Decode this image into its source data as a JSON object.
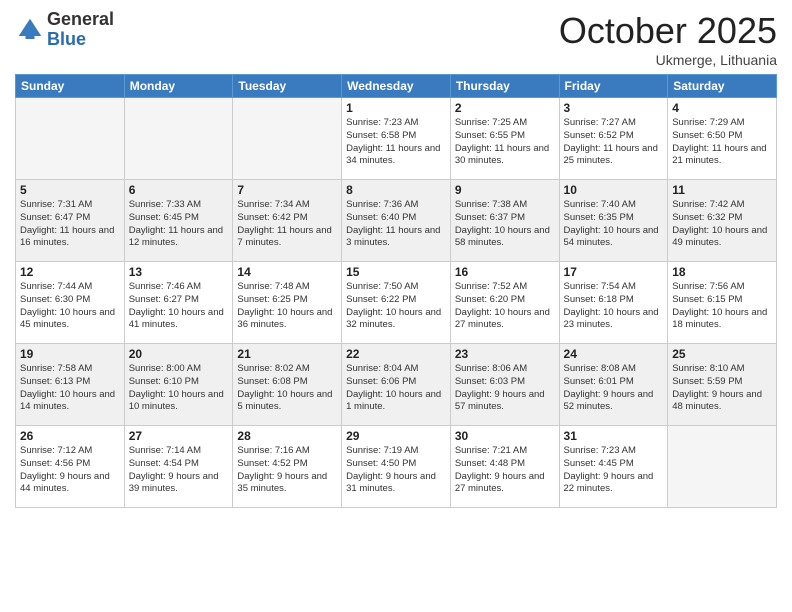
{
  "header": {
    "logo_general": "General",
    "logo_blue": "Blue",
    "month": "October 2025",
    "location": "Ukmerge, Lithuania"
  },
  "weekdays": [
    "Sunday",
    "Monday",
    "Tuesday",
    "Wednesday",
    "Thursday",
    "Friday",
    "Saturday"
  ],
  "weeks": [
    [
      {
        "day": "",
        "sunrise": "",
        "sunset": "",
        "daylight": "",
        "empty": true
      },
      {
        "day": "",
        "sunrise": "",
        "sunset": "",
        "daylight": "",
        "empty": true
      },
      {
        "day": "",
        "sunrise": "",
        "sunset": "",
        "daylight": "",
        "empty": true
      },
      {
        "day": "1",
        "sunrise": "Sunrise: 7:23 AM",
        "sunset": "Sunset: 6:58 PM",
        "daylight": "Daylight: 11 hours and 34 minutes."
      },
      {
        "day": "2",
        "sunrise": "Sunrise: 7:25 AM",
        "sunset": "Sunset: 6:55 PM",
        "daylight": "Daylight: 11 hours and 30 minutes."
      },
      {
        "day": "3",
        "sunrise": "Sunrise: 7:27 AM",
        "sunset": "Sunset: 6:52 PM",
        "daylight": "Daylight: 11 hours and 25 minutes."
      },
      {
        "day": "4",
        "sunrise": "Sunrise: 7:29 AM",
        "sunset": "Sunset: 6:50 PM",
        "daylight": "Daylight: 11 hours and 21 minutes."
      }
    ],
    [
      {
        "day": "5",
        "sunrise": "Sunrise: 7:31 AM",
        "sunset": "Sunset: 6:47 PM",
        "daylight": "Daylight: 11 hours and 16 minutes."
      },
      {
        "day": "6",
        "sunrise": "Sunrise: 7:33 AM",
        "sunset": "Sunset: 6:45 PM",
        "daylight": "Daylight: 11 hours and 12 minutes."
      },
      {
        "day": "7",
        "sunrise": "Sunrise: 7:34 AM",
        "sunset": "Sunset: 6:42 PM",
        "daylight": "Daylight: 11 hours and 7 minutes."
      },
      {
        "day": "8",
        "sunrise": "Sunrise: 7:36 AM",
        "sunset": "Sunset: 6:40 PM",
        "daylight": "Daylight: 11 hours and 3 minutes."
      },
      {
        "day": "9",
        "sunrise": "Sunrise: 7:38 AM",
        "sunset": "Sunset: 6:37 PM",
        "daylight": "Daylight: 10 hours and 58 minutes."
      },
      {
        "day": "10",
        "sunrise": "Sunrise: 7:40 AM",
        "sunset": "Sunset: 6:35 PM",
        "daylight": "Daylight: 10 hours and 54 minutes."
      },
      {
        "day": "11",
        "sunrise": "Sunrise: 7:42 AM",
        "sunset": "Sunset: 6:32 PM",
        "daylight": "Daylight: 10 hours and 49 minutes."
      }
    ],
    [
      {
        "day": "12",
        "sunrise": "Sunrise: 7:44 AM",
        "sunset": "Sunset: 6:30 PM",
        "daylight": "Daylight: 10 hours and 45 minutes."
      },
      {
        "day": "13",
        "sunrise": "Sunrise: 7:46 AM",
        "sunset": "Sunset: 6:27 PM",
        "daylight": "Daylight: 10 hours and 41 minutes."
      },
      {
        "day": "14",
        "sunrise": "Sunrise: 7:48 AM",
        "sunset": "Sunset: 6:25 PM",
        "daylight": "Daylight: 10 hours and 36 minutes."
      },
      {
        "day": "15",
        "sunrise": "Sunrise: 7:50 AM",
        "sunset": "Sunset: 6:22 PM",
        "daylight": "Daylight: 10 hours and 32 minutes."
      },
      {
        "day": "16",
        "sunrise": "Sunrise: 7:52 AM",
        "sunset": "Sunset: 6:20 PM",
        "daylight": "Daylight: 10 hours and 27 minutes."
      },
      {
        "day": "17",
        "sunrise": "Sunrise: 7:54 AM",
        "sunset": "Sunset: 6:18 PM",
        "daylight": "Daylight: 10 hours and 23 minutes."
      },
      {
        "day": "18",
        "sunrise": "Sunrise: 7:56 AM",
        "sunset": "Sunset: 6:15 PM",
        "daylight": "Daylight: 10 hours and 18 minutes."
      }
    ],
    [
      {
        "day": "19",
        "sunrise": "Sunrise: 7:58 AM",
        "sunset": "Sunset: 6:13 PM",
        "daylight": "Daylight: 10 hours and 14 minutes."
      },
      {
        "day": "20",
        "sunrise": "Sunrise: 8:00 AM",
        "sunset": "Sunset: 6:10 PM",
        "daylight": "Daylight: 10 hours and 10 minutes."
      },
      {
        "day": "21",
        "sunrise": "Sunrise: 8:02 AM",
        "sunset": "Sunset: 6:08 PM",
        "daylight": "Daylight: 10 hours and 5 minutes."
      },
      {
        "day": "22",
        "sunrise": "Sunrise: 8:04 AM",
        "sunset": "Sunset: 6:06 PM",
        "daylight": "Daylight: 10 hours and 1 minute."
      },
      {
        "day": "23",
        "sunrise": "Sunrise: 8:06 AM",
        "sunset": "Sunset: 6:03 PM",
        "daylight": "Daylight: 9 hours and 57 minutes."
      },
      {
        "day": "24",
        "sunrise": "Sunrise: 8:08 AM",
        "sunset": "Sunset: 6:01 PM",
        "daylight": "Daylight: 9 hours and 52 minutes."
      },
      {
        "day": "25",
        "sunrise": "Sunrise: 8:10 AM",
        "sunset": "Sunset: 5:59 PM",
        "daylight": "Daylight: 9 hours and 48 minutes."
      }
    ],
    [
      {
        "day": "26",
        "sunrise": "Sunrise: 7:12 AM",
        "sunset": "Sunset: 4:56 PM",
        "daylight": "Daylight: 9 hours and 44 minutes."
      },
      {
        "day": "27",
        "sunrise": "Sunrise: 7:14 AM",
        "sunset": "Sunset: 4:54 PM",
        "daylight": "Daylight: 9 hours and 39 minutes."
      },
      {
        "day": "28",
        "sunrise": "Sunrise: 7:16 AM",
        "sunset": "Sunset: 4:52 PM",
        "daylight": "Daylight: 9 hours and 35 minutes."
      },
      {
        "day": "29",
        "sunrise": "Sunrise: 7:19 AM",
        "sunset": "Sunset: 4:50 PM",
        "daylight": "Daylight: 9 hours and 31 minutes."
      },
      {
        "day": "30",
        "sunrise": "Sunrise: 7:21 AM",
        "sunset": "Sunset: 4:48 PM",
        "daylight": "Daylight: 9 hours and 27 minutes."
      },
      {
        "day": "31",
        "sunrise": "Sunrise: 7:23 AM",
        "sunset": "Sunset: 4:45 PM",
        "daylight": "Daylight: 9 hours and 22 minutes."
      },
      {
        "day": "",
        "sunrise": "",
        "sunset": "",
        "daylight": "",
        "empty": true
      }
    ]
  ]
}
